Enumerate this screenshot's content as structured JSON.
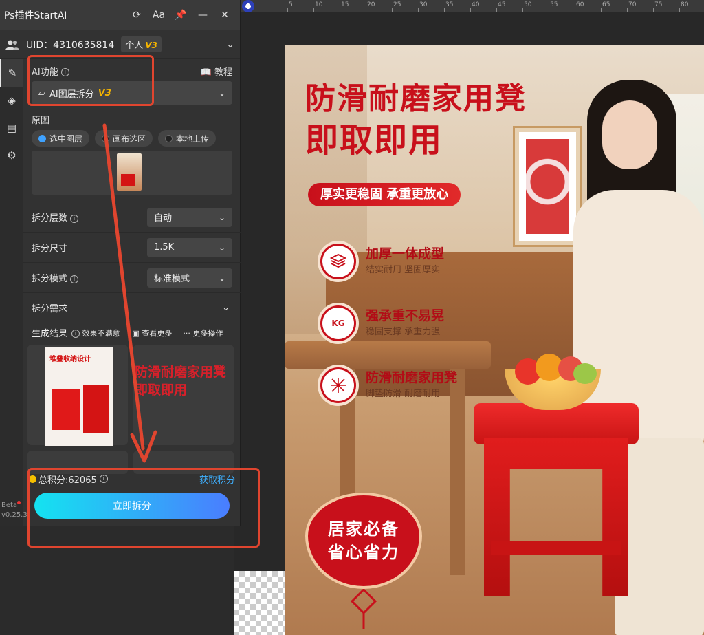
{
  "ruler": {
    "ticks": [
      "5",
      "10",
      "15",
      "20",
      "25",
      "30",
      "35",
      "40",
      "45",
      "50",
      "55",
      "60",
      "65",
      "70",
      "75",
      "80"
    ]
  },
  "panel": {
    "title": "Ps插件StartAI",
    "font_btn": "Aa",
    "uid_label": "UID：4310635814",
    "plan": "个人",
    "plan_version": "V3"
  },
  "ai": {
    "label": "AI功能",
    "tutorial": "教程",
    "selected": "AI图层拆分",
    "selected_version": "V3"
  },
  "source": {
    "label": "原图",
    "options": [
      "选中图层",
      "画布选区",
      "本地上传"
    ],
    "selected_index": 0
  },
  "options": {
    "layers_label": "拆分层数",
    "layers_value": "自动",
    "size_label": "拆分尺寸",
    "size_value": "1.5K",
    "mode_label": "拆分模式",
    "mode_value": "标准模式",
    "demand_label": "拆分需求"
  },
  "results": {
    "label": "生成结果",
    "unsatisfied": "效果不满意",
    "more": "查看更多",
    "more_ops": "··· 更多操作",
    "thumb_title": "堆叠收纳设计",
    "overlay_line1": "防滑耐磨家用凳",
    "overlay_line2": "即取即用"
  },
  "footer": {
    "points_label": "总积分:62065",
    "get_points": "获取积分",
    "split_button": "立即拆分"
  },
  "beta": {
    "label": "Beta",
    "version": "v0.25.3"
  },
  "poster": {
    "headline_line1": "防滑耐磨家用凳",
    "headline_line2": "即取即用",
    "pill": "厚实更稳固 承重更放心",
    "features": [
      {
        "title": "加厚一体成型",
        "sub": "结实耐用 坚固厚实",
        "icon": "layers-icon"
      },
      {
        "title": "强承重不易晃",
        "sub": "稳固支撑 承重力强",
        "icon": "weight-kg-icon"
      },
      {
        "title": "防滑耐磨家用凳",
        "sub": "脚垫防滑 耐磨耐用",
        "icon": "grid-pattern-icon"
      }
    ],
    "kg_text": "KG",
    "seal_line1": "居家必备",
    "seal_line2": "省心省力"
  },
  "colors": {
    "accent_red": "#c8101b",
    "highlight": "#e0452f",
    "button_start": "#14e3f0",
    "button_end": "#4a7dff",
    "link_blue": "#3fb0ff",
    "v3_gold": "#f5b400"
  }
}
